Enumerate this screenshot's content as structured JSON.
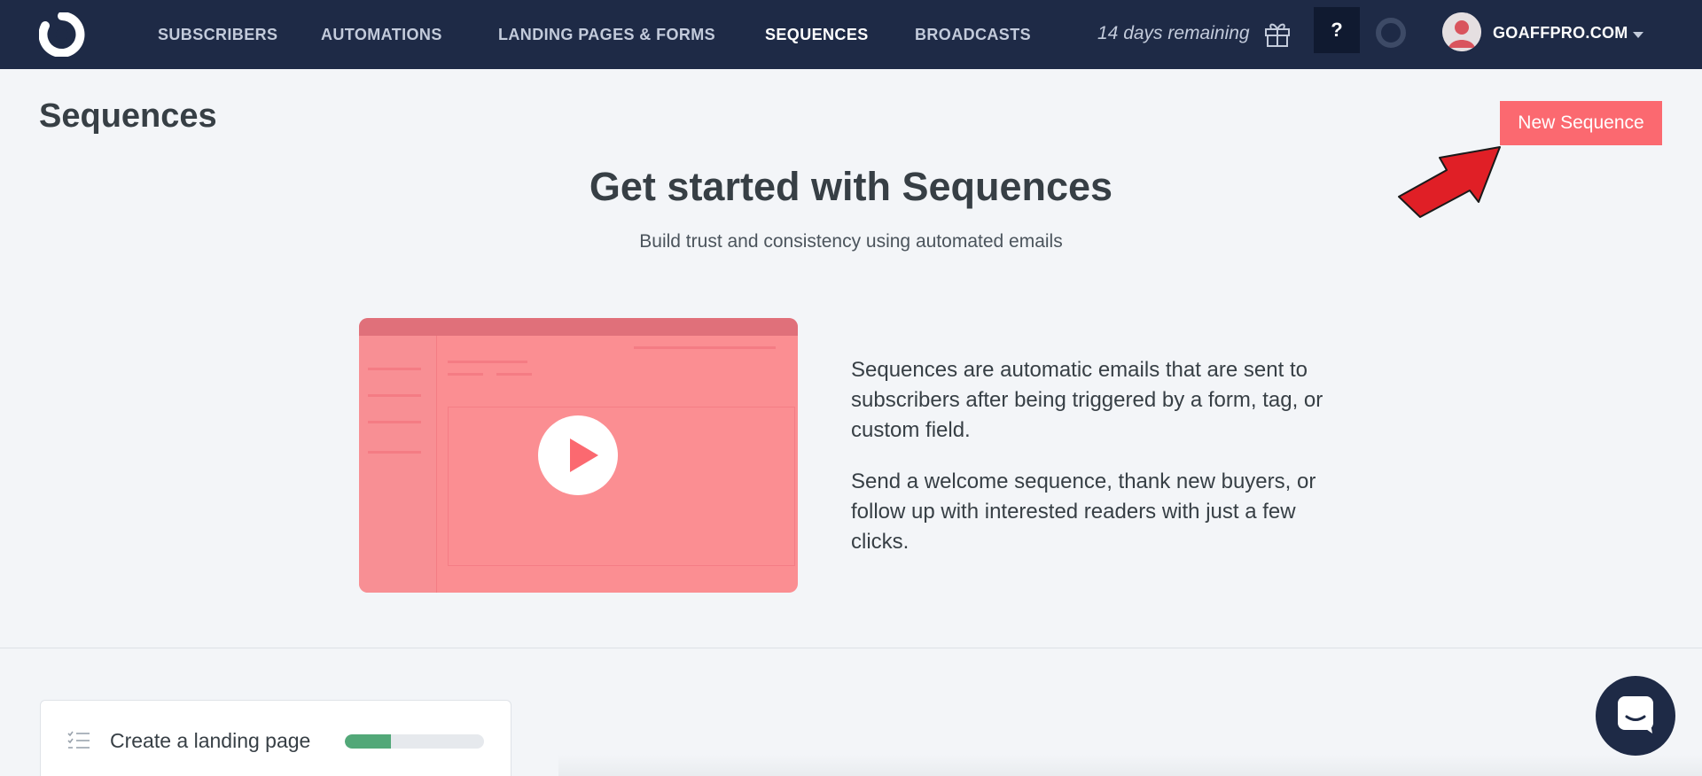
{
  "nav": {
    "items": [
      {
        "label": "SUBSCRIBERS",
        "active": false
      },
      {
        "label": "AUTOMATIONS",
        "active": false
      },
      {
        "label": "LANDING PAGES & FORMS",
        "active": false
      },
      {
        "label": "SEQUENCES",
        "active": true
      },
      {
        "label": "BROADCASTS",
        "active": false
      }
    ],
    "trial_text": "14 days remaining",
    "help_label": "?",
    "account_label": "GOAFFPRO.COM"
  },
  "page": {
    "title": "Sequences",
    "new_button_label": "New Sequence"
  },
  "hero": {
    "title": "Get started with Sequences",
    "subtitle": "Build trust and consistency using automated emails",
    "paragraph1": "Sequences are automatic emails that are sent to subscribers after being triggered by a form, tag, or custom field.",
    "paragraph2": "Send a welcome sequence, thank new buyers, or follow up with interested readers with just a few clicks."
  },
  "checklist": {
    "label": "Create a landing page",
    "progress": 0.33
  },
  "colors": {
    "nav_bg": "#1e2a46",
    "accent": "#fb6970",
    "progress": "#52a878",
    "page_bg": "#f3f5f8"
  }
}
